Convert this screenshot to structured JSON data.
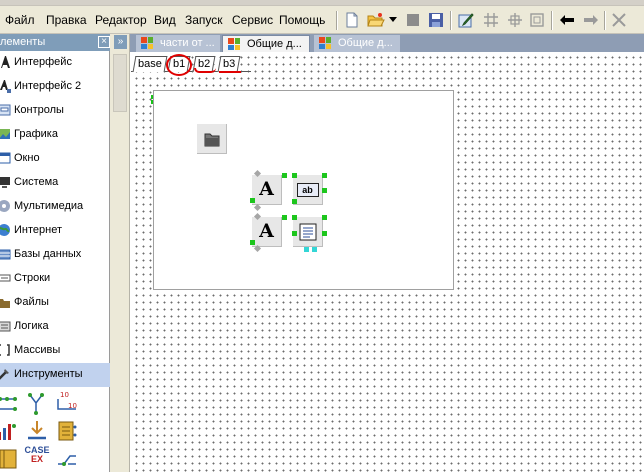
{
  "menu": {
    "items": [
      "Файл",
      "Правка",
      "Редактор",
      "Вид",
      "Запуск",
      "Сервис",
      "Помощь"
    ]
  },
  "toolbar": {
    "buttons": [
      "new-file-icon",
      "open-folder-icon",
      "dropdown-arrow-icon",
      "stop-icon",
      "save-icon",
      "edit-properties-icon",
      "grid-icon",
      "snap-grid-icon",
      "fit-frame-icon",
      "back-arrow-icon",
      "forward-arrow-icon",
      "close-icon"
    ]
  },
  "palette": {
    "title": "лементы",
    "close_glyph": "×",
    "collapse_glyph": "»",
    "items": [
      {
        "label": "Интерфейс",
        "icon": "interface-icon"
      },
      {
        "label": "Интерфейс 2",
        "icon": "interface2-icon"
      },
      {
        "label": "Контролы",
        "icon": "controls-icon"
      },
      {
        "label": "Графика",
        "icon": "graphics-icon"
      },
      {
        "label": "Окно",
        "icon": "window-icon"
      },
      {
        "label": "Система",
        "icon": "system-icon"
      },
      {
        "label": "Мультимедиа",
        "icon": "multimedia-icon"
      },
      {
        "label": "Интернет",
        "icon": "internet-icon"
      },
      {
        "label": "Базы данных",
        "icon": "database-icon"
      },
      {
        "label": "Строки",
        "icon": "strings-icon"
      },
      {
        "label": "Файлы",
        "icon": "files-icon"
      },
      {
        "label": "Логика",
        "icon": "logic-icon"
      },
      {
        "label": "Массивы",
        "icon": "arrays-icon"
      },
      {
        "label": "Инструменты",
        "icon": "tools-icon",
        "selected": true
      }
    ],
    "tool_icons": [
      "branch-icon",
      "hub-icon",
      "counter-icon",
      "chart-tool-icon",
      "import-icon",
      "memory-icon",
      "library-icon",
      "case-icon",
      "switch-icon"
    ],
    "case_label_top": "CASE",
    "case_label_bottom": "EX"
  },
  "doc_tabs": [
    {
      "label": "части от ...",
      "active": false
    },
    {
      "label": "Общие д...",
      "active": true
    },
    {
      "label": "Общие д...",
      "active": false
    }
  ],
  "page_tabs": [
    "base",
    "b1",
    "b2",
    "b3"
  ],
  "form": {
    "components": [
      {
        "name": "folder-component",
        "icon": "folder-icon"
      },
      {
        "name": "label-component-1",
        "text": "A"
      },
      {
        "name": "edit-component",
        "text": "ab"
      },
      {
        "name": "label-component-2",
        "text": "A"
      },
      {
        "name": "memo-component",
        "icon": "memo-icon"
      }
    ]
  },
  "colors": {
    "menubar": "#ece9d8",
    "panel_header": "#7f9db9",
    "tools_selected": "#c1d2ee",
    "doc_tab_strip": "#8e9db4",
    "selection_handle": "#1dc61d",
    "red_annotation": "#e00000"
  }
}
